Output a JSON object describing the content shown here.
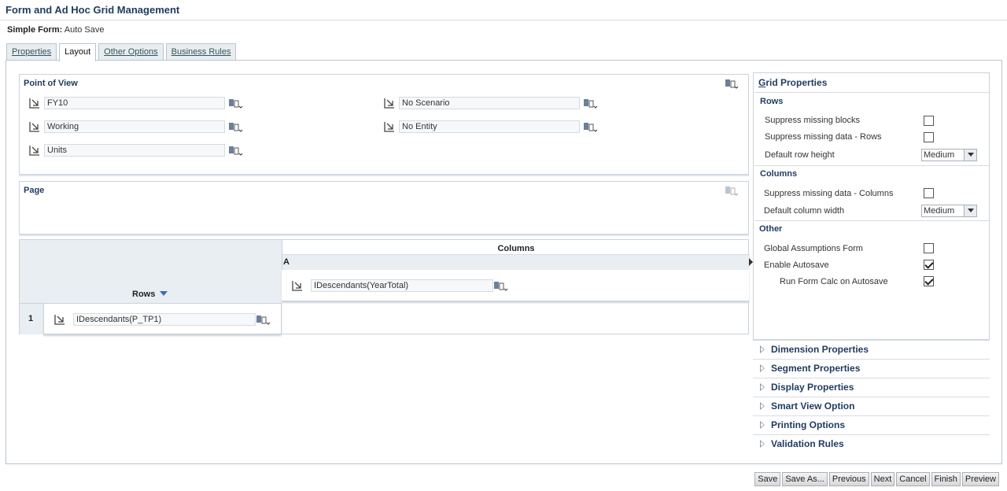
{
  "header": {
    "title": "Form and Ad Hoc Grid Management"
  },
  "form": {
    "label": "Simple Form:",
    "name": "Auto Save"
  },
  "tabs": [
    {
      "label": "Properties"
    },
    {
      "label": "Layout"
    },
    {
      "label": "Other Options"
    },
    {
      "label": "Business Rules"
    }
  ],
  "pov": {
    "title": "Point of View",
    "members": [
      "FY10",
      "Working",
      "Units",
      "No Scenario",
      "No Entity"
    ]
  },
  "page": {
    "title": "Page"
  },
  "grid": {
    "rows_label": "Rows",
    "columns_label": "Columns",
    "column_letter": "A",
    "column_member": "IDescendants(YearTotal)",
    "row_number": "1",
    "row_member": "IDescendants(P_TP1)"
  },
  "grid_properties": {
    "title_prefix": "G",
    "title_rest": "rid Properties",
    "rows_section": "Rows",
    "suppress_missing_blocks": {
      "label": "Suppress missing blocks",
      "checked": false
    },
    "suppress_missing_rows": {
      "label": "Suppress missing data - Rows",
      "checked": false
    },
    "default_row_height": {
      "label": "Default row height",
      "value": "Medium"
    },
    "columns_section": "Columns",
    "suppress_missing_columns": {
      "label": "Suppress missing data - Columns",
      "checked": false
    },
    "default_column_width": {
      "label": "Default column width",
      "value": "Medium"
    },
    "other_section": "Other",
    "global_assumptions": {
      "label": "Global Assumptions Form",
      "checked": false
    },
    "enable_autosave": {
      "label": "Enable Autosave",
      "checked": true
    },
    "run_form_calc": {
      "label": "Run Form Calc on Autosave",
      "checked": true
    }
  },
  "accordions": [
    "Dimension Properties",
    "Segment Properties",
    "Display Properties",
    "Smart View Option",
    "Printing Options",
    "Validation Rules"
  ],
  "footer": {
    "buttons": [
      "Save",
      "Save As...",
      "Previous",
      "Next",
      "Cancel",
      "Finish",
      "Preview"
    ]
  },
  "icons": {
    "member_selector": "member-selector-icon",
    "member_options": "member-options-icon"
  },
  "colors": {
    "title": "#1f3a5f",
    "header_bg": "#e9eef3",
    "border": "#cbd3dc"
  }
}
